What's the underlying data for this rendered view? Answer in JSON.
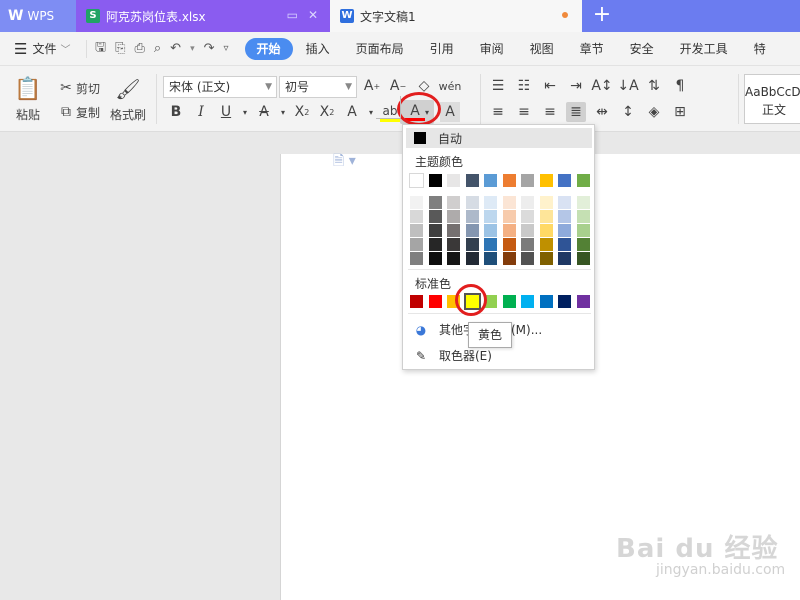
{
  "tabs": {
    "wps_label": "WPS",
    "xlsx_label": "阿克苏岗位表.xlsx",
    "doc_label": "文字文稿1",
    "new_tab": "+"
  },
  "menu": {
    "file": "文件",
    "items": [
      "开始",
      "插入",
      "页面布局",
      "引用",
      "审阅",
      "视图",
      "章节",
      "安全",
      "开发工具",
      "特"
    ]
  },
  "ribbon": {
    "paste": "粘贴",
    "cut": "剪切",
    "copy": "复制",
    "format_painter": "格式刷",
    "font_name": "宋体 (正文)",
    "font_size": "初号",
    "style_preview": "AaBbCcDd",
    "style_name": "正文"
  },
  "color_menu": {
    "auto": "自动",
    "theme_title": "主题颜色",
    "standard_title": "标准色",
    "more_colors": "其他字体颜色(M)...",
    "picker": "取色器(E)",
    "tooltip": "黄色",
    "theme_top": [
      "#ffffff",
      "#000000",
      "#e7e6e6",
      "#44546a",
      "#5b9bd5",
      "#ed7d31",
      "#a5a5a5",
      "#ffc000",
      "#4472c4",
      "#70ad47"
    ],
    "theme_shades": [
      [
        "#f2f2f2",
        "#7f7f7f",
        "#d0cece",
        "#d6dce4",
        "#deeaf6",
        "#fbe5d5",
        "#ededed",
        "#fff2cc",
        "#d9e2f3",
        "#e2efd9"
      ],
      [
        "#d8d8d8",
        "#595959",
        "#aeabab",
        "#adb9ca",
        "#bdd7ee",
        "#f7cbac",
        "#dbdbdb",
        "#fee599",
        "#b4c6e7",
        "#c5e0b3"
      ],
      [
        "#bfbfbf",
        "#3f3f3f",
        "#757070",
        "#8496b0",
        "#9cc3e5",
        "#f4b083",
        "#c9c9c9",
        "#ffd965",
        "#8eaadb",
        "#a8d08d"
      ],
      [
        "#a5a5a5",
        "#262626",
        "#3a3838",
        "#323f4f",
        "#2e75b5",
        "#c55a11",
        "#7b7b7b",
        "#bf9000",
        "#2f5496",
        "#538135"
      ],
      [
        "#7f7f7f",
        "#0d0d0d",
        "#161616",
        "#222a35",
        "#1e4e79",
        "#833c0b",
        "#525252",
        "#7f6000",
        "#1f3864",
        "#375623"
      ]
    ],
    "standard": [
      "#c00000",
      "#ff0000",
      "#ffc000",
      "#ffff00",
      "#92d050",
      "#00b050",
      "#00b0f0",
      "#0070c0",
      "#002060",
      "#7030a0"
    ]
  },
  "watermark": {
    "logo": "Bai du 经验",
    "url": "jingyan.baidu.com"
  }
}
